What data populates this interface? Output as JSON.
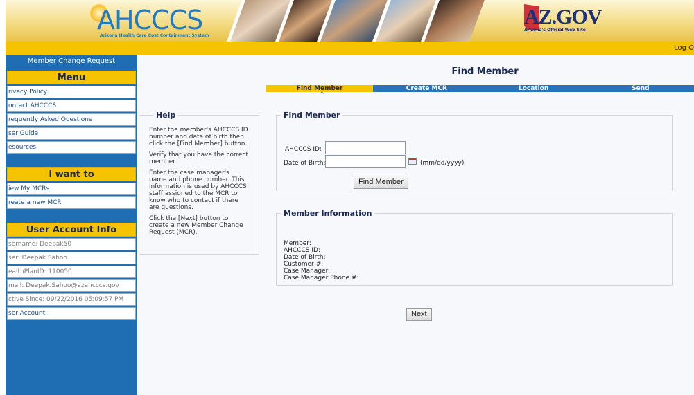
{
  "banner": {
    "logo_text": "AHCCCS",
    "logo_tagline": "Arizona Health Care Cost Containment System",
    "azgov_text": "AZ.GOV",
    "azgov_tagline": "Arizona's Official Web Site"
  },
  "top_strip": {
    "logout_label": "Log O"
  },
  "sidebar": {
    "header": "Member Change Request",
    "menu": {
      "title": "Menu",
      "items": [
        "rivacy Policy",
        "ontact AHCCCS",
        "requently Asked Questions",
        "ser Guide",
        "esources"
      ]
    },
    "i_want_to": {
      "title": "I want to",
      "items": [
        "iew My MCRs",
        "reate a new MCR"
      ]
    },
    "account": {
      "title": "User Account Info",
      "items": [
        "sername: Deepak50",
        "ser: Deepak Sahoo",
        "ealthPlanID: 110050",
        "mail: Deepak.Sahoo@azahcccs.gov",
        "ctive Since: 09/22/2016 05:09:57 PM"
      ],
      "link": "ser Account"
    }
  },
  "main": {
    "title": "Find Member",
    "steps": [
      "Find Member",
      "Create MCR",
      "Location",
      "Send"
    ],
    "active_step": 0,
    "help": {
      "legend": "Help",
      "paragraphs": [
        "Enter the member's AHCCCS ID number and date of birth then click the [Find Member] button.",
        "Verify that you have the correct member.",
        "Enter the case manager's name and phone number. This information is used by AHCCCS staff assigned to the MCR to know who to contact if there are questions.",
        "Click the [Next] button to create a new Member Change Request (MCR)."
      ]
    },
    "find_member": {
      "legend": "Find Member",
      "id_label": "AHCCCS ID:",
      "id_value": "",
      "dob_label": "Date of Birth:",
      "dob_value": "",
      "dob_hint": "(mm/dd/yyyy)",
      "button": "Find Member"
    },
    "member_info": {
      "legend": "Member Information",
      "lines": [
        "Member:",
        "AHCCCS ID:",
        "Date of Birth:",
        "Customer #:",
        "Case Manager:",
        "Case Manager Phone #:"
      ]
    },
    "next_button": "Next"
  },
  "colors": {
    "brand_blue": "#1f6eb3",
    "accent_yellow": "#f5c300",
    "title_navy": "#1b2a59"
  },
  "icons": {
    "calendar": "calendar-icon"
  }
}
